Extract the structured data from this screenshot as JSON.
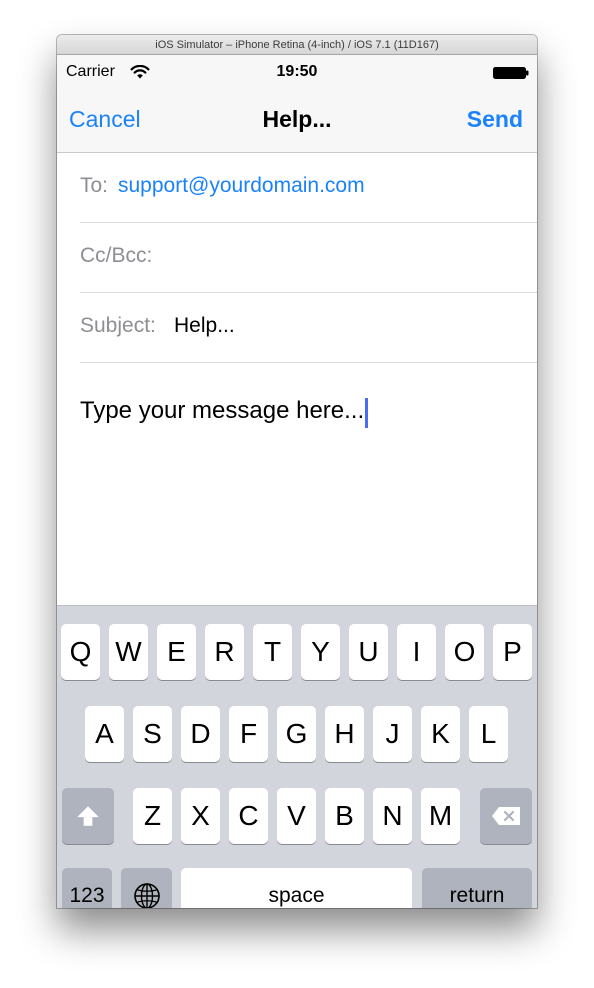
{
  "window": {
    "title": "iOS Simulator – iPhone Retina (4-inch) / iOS 7.1 (11D167)"
  },
  "status_bar": {
    "carrier": "Carrier",
    "time": "19:50",
    "icons": [
      "wifi-icon",
      "battery-icon"
    ]
  },
  "nav": {
    "cancel_label": "Cancel",
    "title": "Help...",
    "send_label": "Send"
  },
  "compose": {
    "to_label": "To:",
    "to_value": "support@yourdomain.com",
    "ccbcc_label": "Cc/Bcc:",
    "ccbcc_value": "",
    "subject_label": "Subject:",
    "subject_value": "Help...",
    "body": "Type your message here..."
  },
  "keyboard": {
    "row1": [
      "Q",
      "W",
      "E",
      "R",
      "T",
      "Y",
      "U",
      "I",
      "O",
      "P"
    ],
    "row2": [
      "A",
      "S",
      "D",
      "F",
      "G",
      "H",
      "J",
      "K",
      "L"
    ],
    "row3": [
      "Z",
      "X",
      "C",
      "V",
      "B",
      "N",
      "M"
    ],
    "numbers_label": "123",
    "space_label": "space",
    "return_label": "return",
    "icons": [
      "shift-icon",
      "delete-icon",
      "globe-icon"
    ]
  },
  "colors": {
    "accent": "#1a82fb",
    "placeholder_gray": "#8e8e93",
    "keyboard_bg": "#d2d5db",
    "cursor": "#4b6cf0"
  }
}
